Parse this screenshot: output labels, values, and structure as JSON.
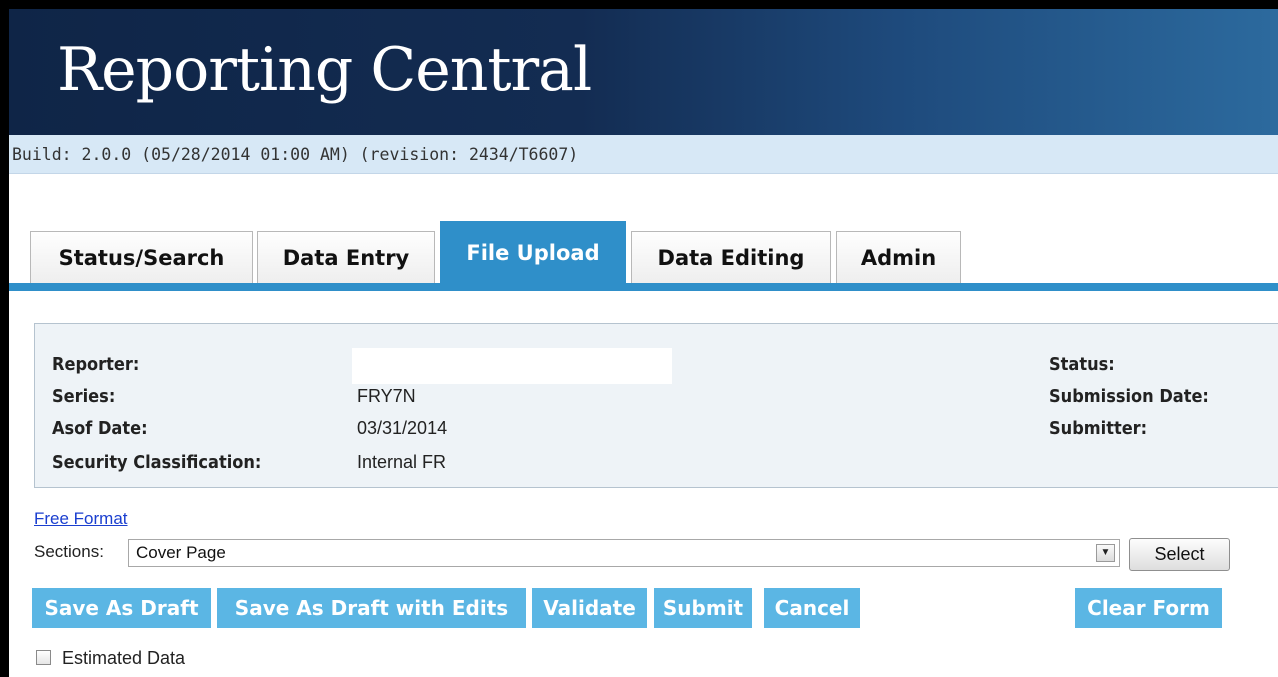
{
  "app": {
    "title": "Reporting Central",
    "build": "Build: 2.0.0 (05/28/2014 01:00 AM) (revision: 2434/T6607)"
  },
  "tabs": [
    {
      "label": "Status/Search",
      "active": false
    },
    {
      "label": "Data Entry",
      "active": false
    },
    {
      "label": "File Upload",
      "active": true
    },
    {
      "label": "Data Editing",
      "active": false
    },
    {
      "label": "Admin",
      "active": false
    }
  ],
  "info": {
    "reporter_label": "Reporter:",
    "reporter_value": "",
    "series_label": "Series:",
    "series_value": "FRY7N",
    "asof_label": "Asof Date:",
    "asof_value": "03/31/2014",
    "security_label": "Security Classification:",
    "security_value": "Internal FR",
    "status_label": "Status:",
    "submission_date_label": "Submission Date:",
    "submitter_label": "Submitter:"
  },
  "form": {
    "free_format_link": "Free Format",
    "sections_label": "Sections:",
    "sections_selected": "Cover Page",
    "select_button": "Select"
  },
  "actions": {
    "save_as_draft": "Save As Draft",
    "save_as_draft_with_edits": "Save As Draft with Edits",
    "validate": "Validate",
    "submit": "Submit",
    "cancel": "Cancel",
    "clear_form": "Clear Form"
  },
  "options": {
    "estimated_data_label": "Estimated Data",
    "estimated_data_checked": false
  },
  "colors": {
    "banner_dark": "#0f2547",
    "tab_active": "#2f8fc9",
    "action_button": "#5bb6e4",
    "build_bar": "#d7e8f6"
  }
}
